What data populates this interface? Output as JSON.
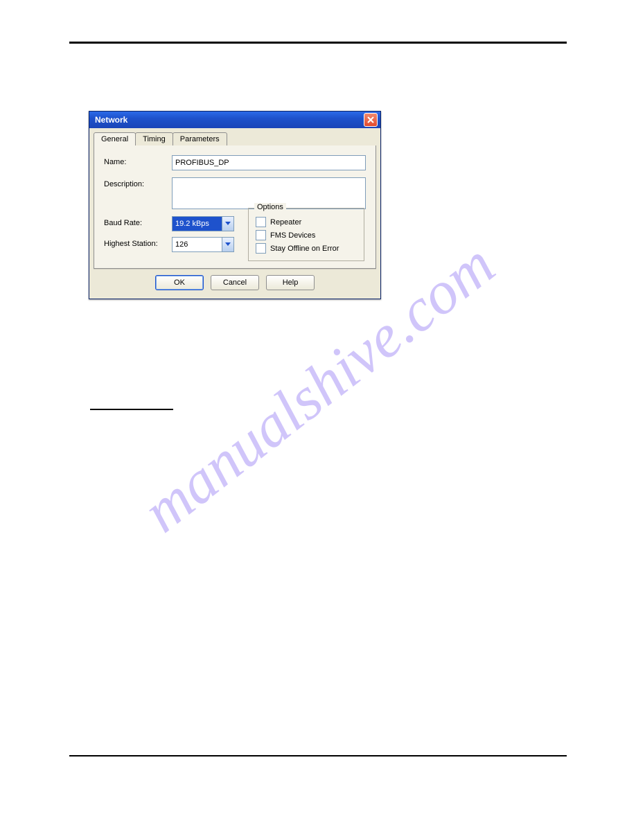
{
  "dialog": {
    "title": "Network",
    "tabs": {
      "general": "General",
      "timing": "Timing",
      "parameters": "Parameters"
    },
    "labels": {
      "name": "Name:",
      "description": "Description:",
      "baud_rate": "Baud Rate:",
      "highest_station": "Highest Station:",
      "options_title": "Options"
    },
    "values": {
      "name": "PROFIBUS_DP",
      "description": "",
      "baud_rate": "19.2 kBps",
      "highest_station": "126"
    },
    "options": {
      "repeater": "Repeater",
      "fms_devices": "FMS Devices",
      "stay_offline": "Stay Offline on Error"
    },
    "buttons": {
      "ok": "OK",
      "cancel": "Cancel",
      "help": "Help"
    }
  },
  "watermark": "manualshive.com"
}
